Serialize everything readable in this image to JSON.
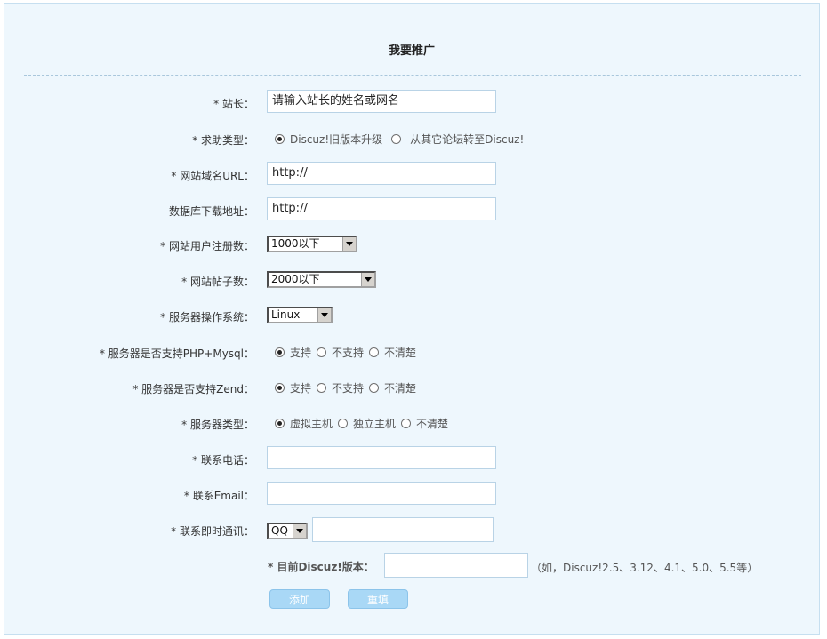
{
  "form": {
    "title": "我要推广",
    "stationmaster": {
      "label": "* 站长：",
      "value": "请输入站长的姓名或网名"
    },
    "help_type": {
      "label": "* 求助类型：",
      "options": [
        "Discuz!旧版本升级",
        "从其它论坛转至Discuz!"
      ],
      "selected": 0
    },
    "site_url": {
      "label": "* 网站域名URL：",
      "value": "http://"
    },
    "db_url": {
      "label": "数据库下载地址：",
      "value": "http://"
    },
    "users": {
      "label": "* 网站用户注册数：",
      "value": "1000以下"
    },
    "posts": {
      "label": "* 网站帖子数：",
      "value": "2000以下"
    },
    "os": {
      "label": "* 服务器操作系统：",
      "value": "Linux"
    },
    "php_mysql": {
      "label": "* 服务器是否支持PHP+Mysql：",
      "options": [
        "支持",
        "不支持",
        "不清楚"
      ],
      "selected": 0
    },
    "zend": {
      "label": "* 服务器是否支持Zend：",
      "options": [
        "支持",
        "不支持",
        "不清楚"
      ],
      "selected": 0
    },
    "server_type": {
      "label": "* 服务器类型：",
      "options": [
        "虚拟主机",
        "独立主机",
        "不清楚"
      ],
      "selected": 0
    },
    "phone": {
      "label": "* 联系电话：",
      "value": ""
    },
    "email": {
      "label": "* 联系Email：",
      "value": ""
    },
    "im": {
      "label": "* 联系即时通讯：",
      "type": "QQ",
      "value": ""
    },
    "version": {
      "label": "* 目前Discuz!版本：",
      "value": "",
      "hint": "（如，Discuz!2.5、3.12、4.1、5.0、5.5等）"
    },
    "buttons": {
      "add": "添加",
      "reset": "重填"
    }
  }
}
